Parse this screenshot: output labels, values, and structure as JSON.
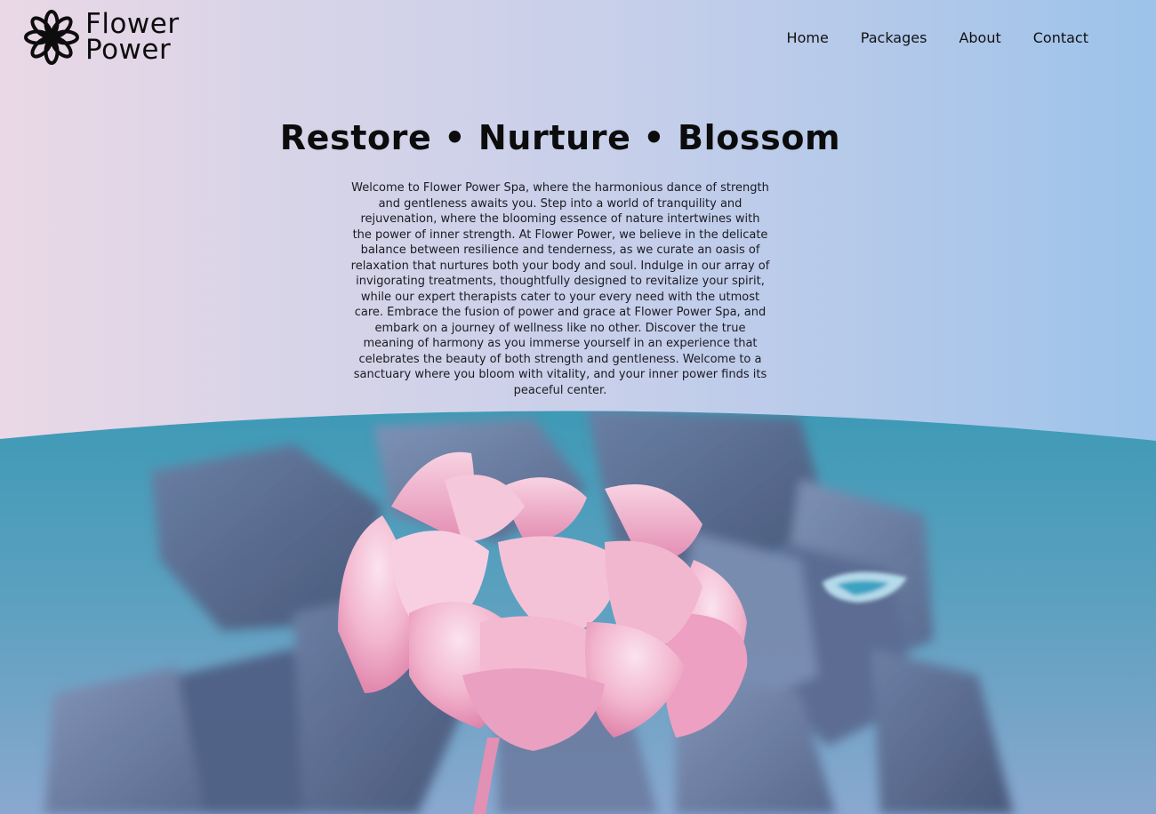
{
  "brand": {
    "line1": "Flower",
    "line2": "Power",
    "icon": "flower-icon"
  },
  "nav": {
    "items": [
      {
        "label": "Home"
      },
      {
        "label": "Packages"
      },
      {
        "label": "About"
      },
      {
        "label": "Contact"
      }
    ]
  },
  "hero": {
    "title": "Restore • Nurture • Blossom",
    "intro": "Welcome to Flower Power Spa, where the harmonious dance of strength and gentleness awaits you. Step into a world of tranquility and rejuvenation, where the blooming essence of nature intertwines with the power of inner strength. At Flower Power, we believe in the delicate balance between resilience and tenderness, as we curate an oasis of relaxation that nurtures both your body and soul. Indulge in our array of invigorating treatments, thoughtfully designed to revitalize your spirit, while our expert therapists cater to your every need with the utmost care. Embrace the fusion of power and grace at Flower Power Spa, and embark on a journey of wellness like no other. Discover the true meaning of harmony as you immerse yourself in an experience that celebrates the beauty of both strength and gentleness. Welcome to a sanctuary where you bloom with vitality, and your inner power finds its peaceful center.",
    "image_subject": "pink-peony-on-blue-stones"
  },
  "colors": {
    "gradient_left": "#ead8e6",
    "gradient_right": "#9cc3ea",
    "text": "#111111",
    "image_teal": "#3f96b0",
    "petal_pink": "#f0a8c4"
  }
}
